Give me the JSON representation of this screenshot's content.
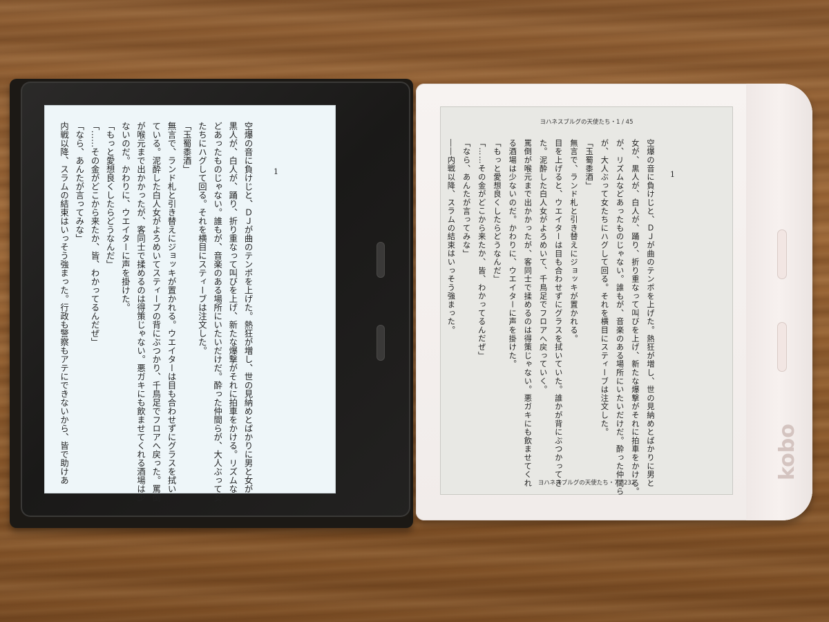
{
  "kindle": {
    "chapter_number": "1",
    "text": "空爆の音に負けじと、ＤＪが曲のテンポを上げた。熱狂が増し、世の見納めとばかりに男と女が\n黒人が、白人が、踊り、折り重なって叫びを上げ、新たな爆撃がそれに拍車をかける。リズムな\nどあったものじゃない。誰もが、音楽のある場所にいたいだけだ。酔った仲間らが、大人ぶって女\nたちにハグして回る。それを横目にスティーブは注文した。\n「玉蜀黍酒」\n無言で、ランド札と引き替えにジョッキが置かれる。ウエイターは目も合わせずにグラスを拭い\nている。泥酔した白人女がよろめいてスティーブの背にぶつかり、千鳥足でフロアへ戻った。罵倒\nが喉元まで出かかったが、客同士で揉めるのは得策じゃない。悪ガキにも飲ませてくれる酒場は少\nないのだ。かわりに、ウエイターに声を掛けた。\n「もっと愛想良くしたらどうなんだ」\n「……その金がどこから来たか、皆、わかってるんだぜ」\n「なら、あんたが言ってみな」\n内戦以降、スラムの結束はいっそう強まった。行政も警察もアテにできないから、皆で助けあ"
  },
  "kobo": {
    "header": "ヨハネスブルグの天使たち・1 / 45",
    "footer": "ヨハネスブルグの天使たち・7 / 232",
    "chapter_number": "1",
    "logo": "kobo",
    "text": "空爆の音に負けじと、ＤＪが曲のテンポを上げた。熱狂が増し、世の見納めとばかりに男と\n女が、黒人が、白人が、踊り、折り重なって叫びを上げ、新たな爆撃がそれに拍車をかける。\nが、リズムなどあったものじゃない。誰もが、音楽のある場所にいたいだけだ。酔った仲間ら\nが、大人ぶって女たちにハグして回る。それを横目にスティーブは注文した。\n「玉蜀黍酒」\n無言で、ランド札と引き替えにジョッキが置かれる。\n目を上げると、ウエイターは目も合わせずにグラスを拭いていた。誰かが背にぶつかってき\nた。泥酔した白人女がよろめいて、千鳥足でフロアへ戻っていく。\n罵倒が喉元まで出かかったが、客同士で揉めるのは得策じゃない。悪ガキにも飲ませてくれ\nる酒場は少ないのだ。かわりに、ウエイターに声を掛けた。\n「もっと愛想良くしたらどうなんだ」\n「……その金がどこから来たか、皆、わかってるんだぜ」\n「なら、あんたが言ってみな」\n――内戦以降、スラムの結束はいっそう強まった。"
  }
}
